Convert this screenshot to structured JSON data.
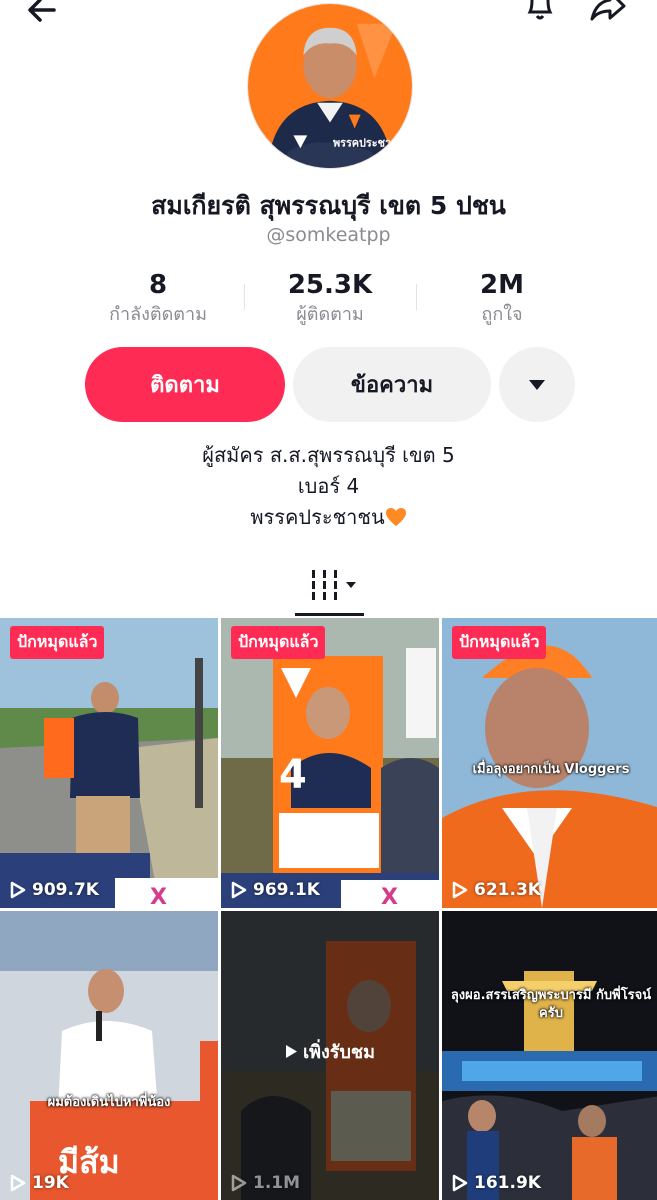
{
  "profile": {
    "name": "สมเกียรติ สุพรรณบุรี เขต 5 ปชน",
    "handle": "@somkeatpp",
    "avatar_badge_text": "พรรคประชาชน"
  },
  "stats": [
    {
      "value": "8",
      "label": "กำลังติดตาม"
    },
    {
      "value": "25.3K",
      "label": "ผู้ติดตาม"
    },
    {
      "value": "2M",
      "label": "ถูกใจ"
    }
  ],
  "actions": {
    "follow_label": "ติดตาม",
    "message_label": "ข้อความ",
    "more_icon": "caret-down-icon"
  },
  "bio": {
    "line1": "ผู้สมัคร ส.ส.สุพรรณบุรี เขต 5",
    "line2": "เบอร์ 4",
    "line3": "พรรคประชาชน"
  },
  "colors": {
    "accent": "#fe2c55",
    "party_orange": "#ff7a1a",
    "button_gray": "#f1f1f2"
  },
  "videos": [
    {
      "pinned_label": "ปักหมุดแล้ว",
      "views": "909.7K",
      "caption": "",
      "overlay": ""
    },
    {
      "pinned_label": "ปักหมุดแล้ว",
      "views": "969.1K",
      "caption": "",
      "overlay": ""
    },
    {
      "pinned_label": "ปักหมุดแล้ว",
      "views": "621.3K",
      "caption": "เมื่อลุงอยากเป็น Vloggers",
      "overlay": ""
    },
    {
      "pinned_label": "",
      "views": "19K",
      "caption": "ผมต้องเดินไปหาพี่น้อง",
      "overlay": ""
    },
    {
      "pinned_label": "",
      "views": "1.1M",
      "caption": "",
      "overlay": "เพิ่งรับชม"
    },
    {
      "pinned_label": "",
      "views": "161.9K",
      "caption": "ลุงผอ.สรรเสริญพระบารมี กับพี่โรจน์ครับ",
      "overlay": ""
    }
  ]
}
